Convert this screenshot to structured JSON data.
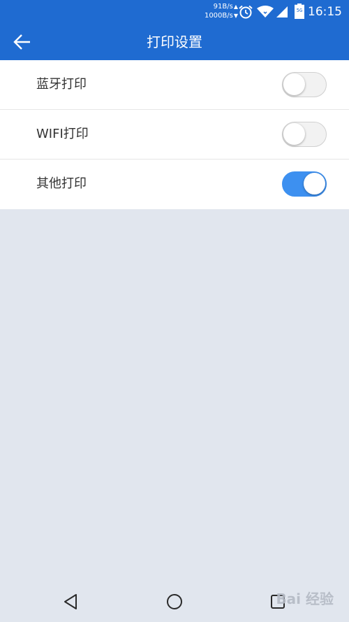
{
  "status_bar": {
    "net_up": "91B/s",
    "net_down": "1000B/s",
    "sim_label": "5G",
    "time": "16:15",
    "icons": [
      "alarm-icon",
      "wifi-icon",
      "signal-icon",
      "battery-icon"
    ]
  },
  "toolbar": {
    "back_icon": "arrow-left-icon",
    "title": "打印设置"
  },
  "settings": [
    {
      "label": "蓝牙打印",
      "enabled": false
    },
    {
      "label": "WIFI打印",
      "enabled": false
    },
    {
      "label": "其他打印",
      "enabled": true
    }
  ],
  "nav_bar": {
    "icons": [
      "back-triangle-icon",
      "home-circle-icon",
      "recents-square-icon"
    ]
  },
  "colors": {
    "app_bar": "#1f6bd1",
    "toggle_on": "#3d90f0",
    "background": "#e1e6ee"
  }
}
